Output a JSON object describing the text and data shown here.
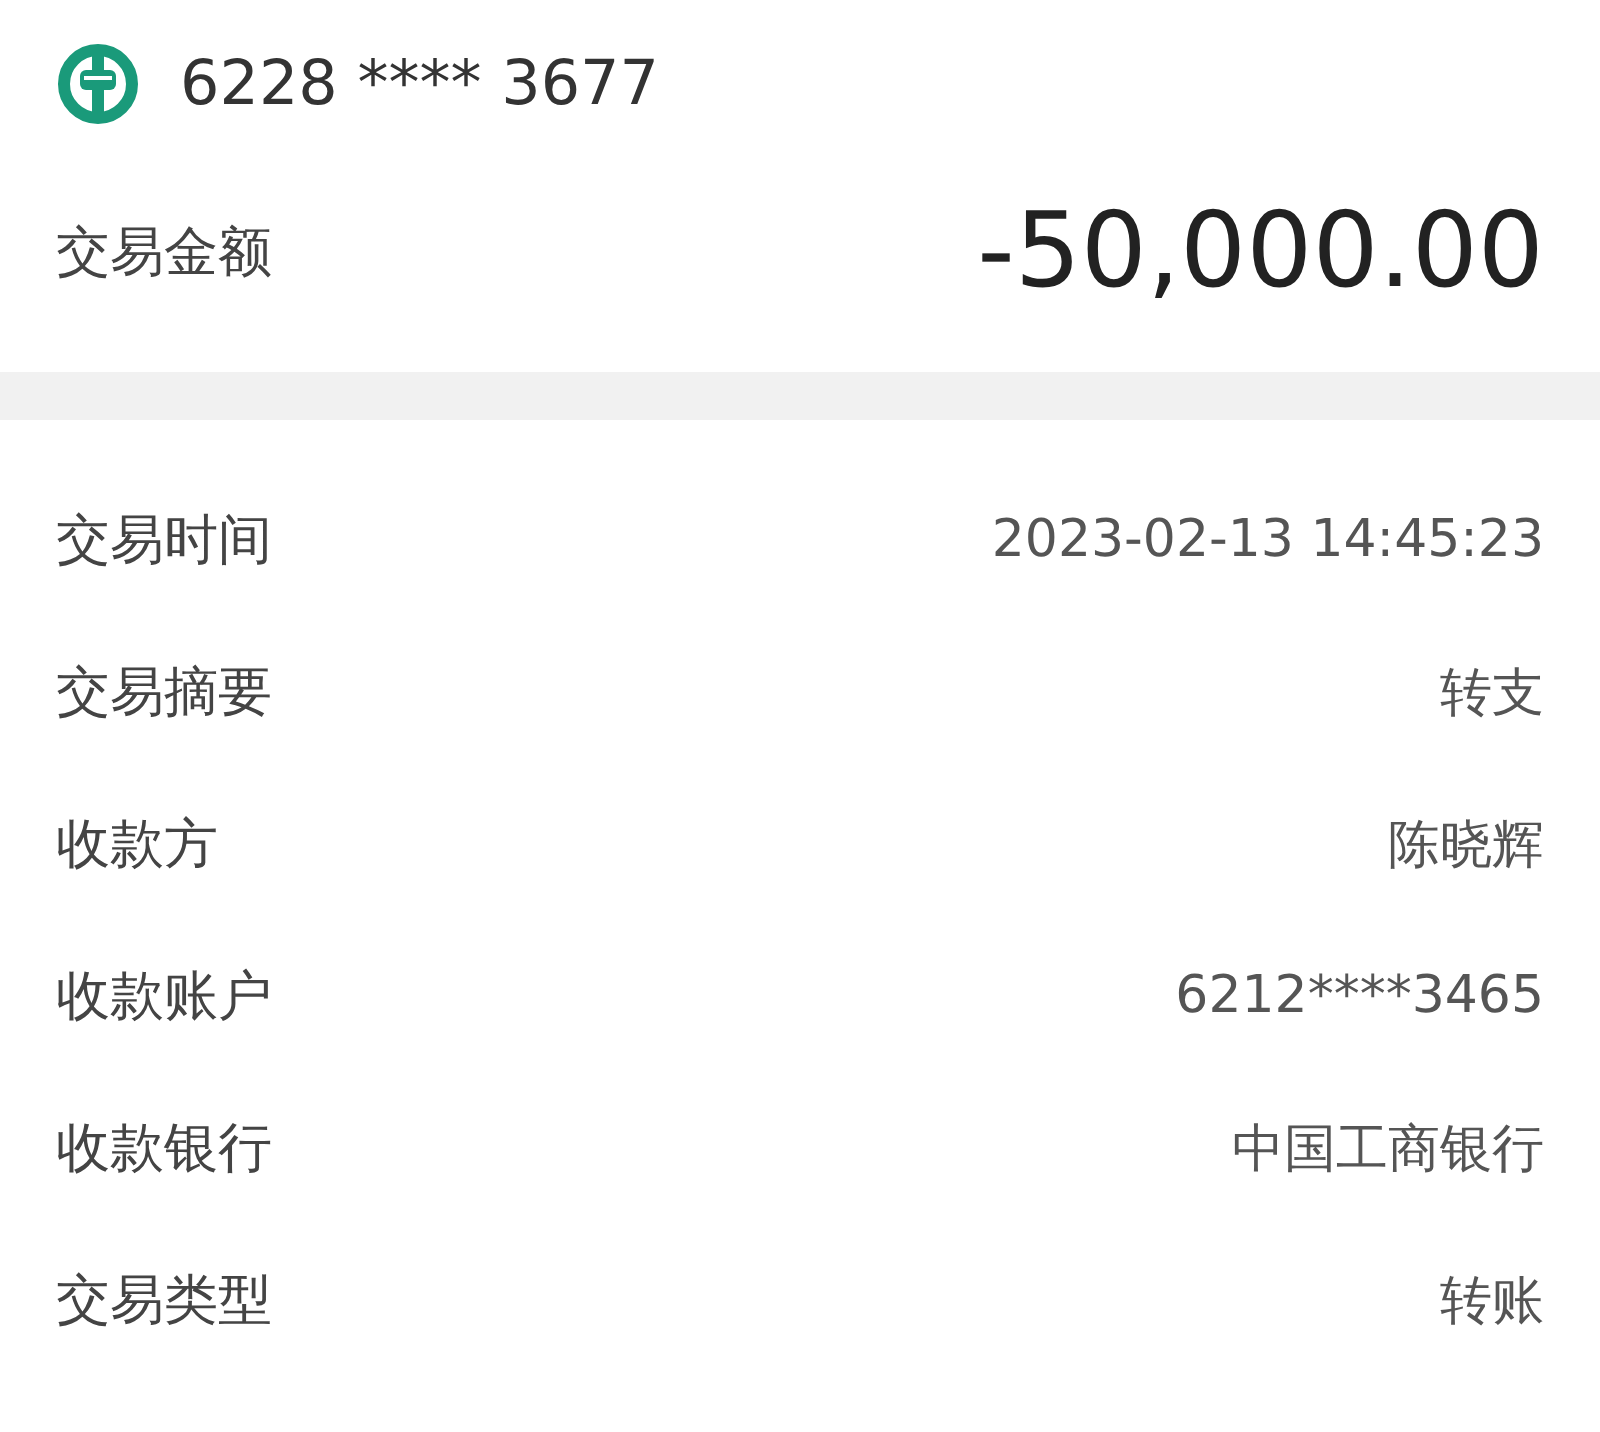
{
  "card": {
    "number": "6228 **** 3677"
  },
  "amount": {
    "label": "交易金额",
    "value": "-50,000.00"
  },
  "details": [
    {
      "label": "交易时间",
      "value": "2023-02-13 14:45:23"
    },
    {
      "label": "交易摘要",
      "value": "转支"
    },
    {
      "label": "收款方",
      "value": "陈晓辉"
    },
    {
      "label": "收款账户",
      "value": "6212****3465"
    },
    {
      "label": "收款银行",
      "value": "中国工商银行"
    },
    {
      "label": "交易类型",
      "value": "转账"
    }
  ]
}
